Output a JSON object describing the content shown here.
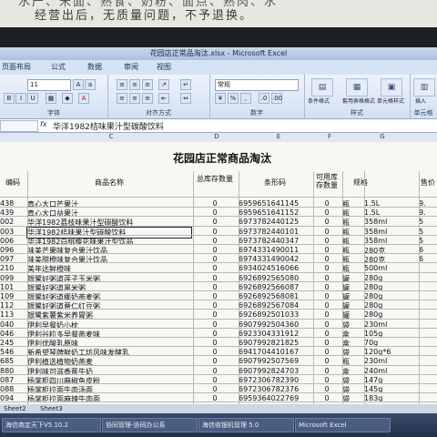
{
  "paper": {
    "line1": "经营出后，无质量问题，不予退换。",
    "line2": "水产、米面、熟食、奶粉、面点、熟肉、水"
  },
  "window": {
    "title": "花园店正常品淘汰.xlsx - Microsoft Excel"
  },
  "menu_tabs": [
    "页面布局",
    "公式",
    "数据",
    "审阅",
    "视图"
  ],
  "ribbon": {
    "font_size": "11",
    "number_format": "常规",
    "groups": [
      "字体",
      "对齐方式",
      "数字",
      "样式",
      "单元格"
    ],
    "style_buttons": [
      "条件格式",
      "套用表格格式",
      "单元格样式"
    ],
    "cell_buttons": [
      "插入",
      "删除",
      "格式"
    ]
  },
  "formula_bar": {
    "content": "华洋1982桔味果汁型碳酸饮料"
  },
  "columns": [
    "C",
    "D",
    "E",
    "F",
    "G"
  ],
  "sheet": {
    "title": "花园店正常商品淘汰",
    "headers": {
      "code": "编码",
      "name": "商品名称",
      "stock": "总库存数量",
      "barcode": "条形码",
      "has_stock": "可用库存数量",
      "spec": "规格",
      "price": "售价"
    },
    "rows": [
      {
        "code": "438",
        "name": "真心大口芒果汁",
        "stock": "0",
        "barcode": "6959651641145",
        "has": "0",
        "unit": "瓶",
        "spec": "1.5L",
        "price": "9."
      },
      {
        "code": "439",
        "name": "真心大口益果汁",
        "stock": "0",
        "barcode": "6959651641152",
        "has": "0",
        "unit": "瓶",
        "spec": "1.5L",
        "price": "9."
      },
      {
        "code": "002",
        "name": "华洋1982荔枝味果汁型碳酸饮料",
        "stock": "0",
        "barcode": "6973782440125",
        "has": "0",
        "unit": "瓶",
        "spec": "358ml",
        "price": "5"
      },
      {
        "code": "003",
        "name": "华洋1982桔味果汁型碳酸饮料",
        "stock": "0",
        "barcode": "6973782440101",
        "has": "0",
        "unit": "瓶",
        "spec": "358ml",
        "price": "5"
      },
      {
        "code": "006",
        "name": "华洋1982白桃樱花味果汁型饮品",
        "stock": "0",
        "barcode": "6973782440347",
        "has": "0",
        "unit": "瓶",
        "spec": "358ml",
        "price": "5"
      },
      {
        "code": "096",
        "name": "味美芒果味复合果汁饮品",
        "stock": "0",
        "barcode": "6974331490011",
        "has": "0",
        "unit": "瓶",
        "spec": "280克",
        "price": "6"
      },
      {
        "code": "097",
        "name": "味美甜橙味复合果汁饮品",
        "stock": "0",
        "barcode": "6974331490042",
        "has": "0",
        "unit": "瓶",
        "spec": "280克",
        "price": "6"
      },
      {
        "code": "210",
        "name": "美年达鲜橙味",
        "stock": "0",
        "barcode": "6934024516066",
        "has": "0",
        "unit": "瓶",
        "spec": "500ml",
        "price": ""
      },
      {
        "code": "099",
        "name": "银鹭好粥道莲子玉米粥",
        "stock": "0",
        "barcode": "6926892565080",
        "has": "0",
        "unit": "罐",
        "spec": "280g",
        "price": ""
      },
      {
        "code": "101",
        "name": "银鹭好粥道黑米粥",
        "stock": "0",
        "barcode": "6926892566087",
        "has": "0",
        "unit": "罐",
        "spec": "280g",
        "price": ""
      },
      {
        "code": "109",
        "name": "银鹭好粥道椰奶燕麦粥",
        "stock": "0",
        "barcode": "6926892568081",
        "has": "0",
        "unit": "罐",
        "spec": "280g",
        "price": ""
      },
      {
        "code": "112",
        "name": "银鹭好粥道薏仁红豆粥",
        "stock": "0",
        "barcode": "6926892567084",
        "has": "0",
        "unit": "罐",
        "spec": "280g",
        "price": ""
      },
      {
        "code": "113",
        "name": "银鹭紫薯紫米养胃粥",
        "stock": "0",
        "barcode": "6926892501033",
        "has": "0",
        "unit": "罐",
        "spec": "280g",
        "price": ""
      },
      {
        "code": "040",
        "name": "伊利早餐奶小枕",
        "stock": "0",
        "barcode": "6907992504360",
        "has": "0",
        "unit": "袋",
        "spec": "230ml",
        "price": ""
      },
      {
        "code": "046",
        "name": "伊利谷粒多早餐燕麦味",
        "stock": "0",
        "barcode": "6923304331912",
        "has": "0",
        "unit": "盒",
        "spec": "105g",
        "price": ""
      },
      {
        "code": "245",
        "name": "伊利优酸乳原味",
        "stock": "0",
        "barcode": "6907992821825",
        "has": "0",
        "unit": "盒",
        "spec": "70g",
        "price": ""
      },
      {
        "code": "546",
        "name": "新希望琴牌鲜奶工坊风味发酵乳",
        "stock": "0",
        "barcode": "6941704410167",
        "has": "0",
        "unit": "袋",
        "spec": "120g*6",
        "price": ""
      },
      {
        "code": "685",
        "name": "伊利植选植物奶燕麦",
        "stock": "0",
        "barcode": "6907992507569",
        "has": "0",
        "unit": "瓶",
        "spec": "230ml",
        "price": ""
      },
      {
        "code": "880",
        "name": "伊利味可滋香蕉牛奶",
        "stock": "0",
        "barcode": "6907992824703",
        "has": "0",
        "unit": "盒",
        "spec": "240ml",
        "price": ""
      },
      {
        "code": "087",
        "name": "杨掌柜四川麻椒鱼皮粉",
        "stock": "0",
        "barcode": "6972306782390",
        "has": "0",
        "unit": "袋",
        "spec": "147g",
        "price": ""
      },
      {
        "code": "088",
        "name": "杨掌柜拉面牛肉汤面",
        "stock": "0",
        "barcode": "6972306782376",
        "has": "0",
        "unit": "袋",
        "spec": "145g",
        "price": ""
      },
      {
        "code": "094",
        "name": "杨掌柜拉面麻辣牛肉面",
        "stock": "0",
        "barcode": "6959364022769",
        "has": "0",
        "unit": "袋",
        "spec": "183g",
        "price": ""
      }
    ]
  },
  "sheet_tabs": [
    "Sheet2",
    "Sheet3"
  ],
  "taskbar": {
    "items": [
      "海信商定天下V5.10.2",
      "协同管理-协同办公系",
      "海信收银机管理 5.0",
      "Microsoft Excel"
    ]
  }
}
